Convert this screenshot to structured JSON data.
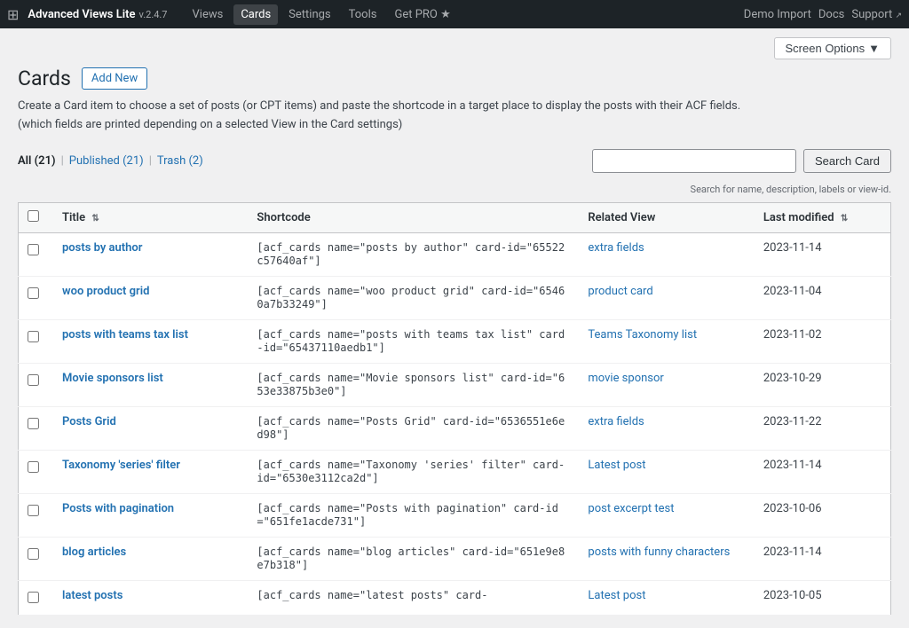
{
  "nav": {
    "brand": "Advanced Views Lite",
    "version": "v.2.4.7",
    "links": [
      "Views",
      "Cards",
      "Settings",
      "Tools",
      "Get PRO ★"
    ],
    "right_links": [
      {
        "label": "Demo Import",
        "ext": false
      },
      {
        "label": "Docs",
        "ext": false
      },
      {
        "label": "Support",
        "ext": true
      }
    ]
  },
  "screen_options": {
    "label": "Screen Options",
    "arrow": "▼"
  },
  "page": {
    "title": "Cards",
    "add_new": "Add New",
    "description_1": "Create a Card item to choose a set of posts (or CPT items) and paste the shortcode in a target place to display the posts with their ACF fields.",
    "description_2": "(which fields are printed depending on a selected View in the Card settings)"
  },
  "filters": {
    "all": {
      "label": "All (21)",
      "active": true
    },
    "published": {
      "label": "Published (21)",
      "active": false
    },
    "trash": {
      "label": "Trash (2)",
      "active": false
    }
  },
  "search": {
    "placeholder": "",
    "button_label": "Search Card",
    "hint": "Search for name, description, labels or view-id."
  },
  "table": {
    "columns": {
      "title": "Title",
      "shortcode": "Shortcode",
      "related_view": "Related View",
      "last_modified": "Last modified"
    },
    "rows": [
      {
        "title": "posts by author",
        "shortcode": "[acf_cards name=\"posts by author\" card-id=\"65522c57640af\"]",
        "related_view": "extra fields",
        "related_view_link": "#",
        "modified": "2023-11-14"
      },
      {
        "title": "woo product grid",
        "shortcode": "[acf_cards name=\"woo product grid\" card-id=\"65460a7b33249\"]",
        "related_view": "product card",
        "related_view_link": "#",
        "modified": "2023-11-04"
      },
      {
        "title": "posts with teams tax list",
        "shortcode": "[acf_cards name=\"posts with teams tax list\" card-id=\"65437110aedb1\"]",
        "related_view": "Teams Taxonomy list",
        "related_view_link": "#",
        "modified": "2023-11-02"
      },
      {
        "title": "Movie sponsors list",
        "shortcode": "[acf_cards name=\"Movie sponsors list\" card-id=\"653e33875b3e0\"]",
        "related_view": "movie sponsor",
        "related_view_link": "#",
        "modified": "2023-10-29"
      },
      {
        "title": "Posts Grid",
        "shortcode": "[acf_cards name=\"Posts Grid\" card-id=\"6536551e6ed98\"]",
        "related_view": "extra fields",
        "related_view_link": "#",
        "modified": "2023-11-22"
      },
      {
        "title": "Taxonomy 'series' filter",
        "shortcode": "[acf_cards name=\"Taxonomy 'series' filter\" card-id=\"6530e3112ca2d\"]",
        "related_view": "Latest post",
        "related_view_link": "#",
        "modified": "2023-11-14"
      },
      {
        "title": "Posts with pagination",
        "shortcode": "[acf_cards name=\"Posts with pagination\" card-id=\"651fe1acde731\"]",
        "related_view": "post excerpt test",
        "related_view_link": "#",
        "modified": "2023-10-06"
      },
      {
        "title": "blog articles",
        "shortcode": "[acf_cards name=\"blog articles\" card-id=\"651e9e8e7b318\"]",
        "related_view": "posts with funny characters",
        "related_view_link": "#",
        "modified": "2023-11-14"
      },
      {
        "title": "latest posts",
        "shortcode": "[acf_cards name=\"latest posts\" card-",
        "related_view": "Latest post",
        "related_view_link": "#",
        "modified": "2023-10-05"
      }
    ]
  }
}
